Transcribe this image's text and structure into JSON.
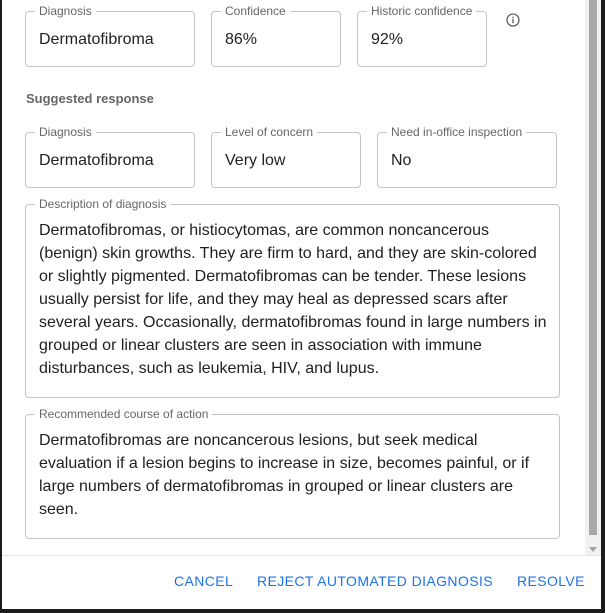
{
  "top_fields": {
    "diagnosis": {
      "label": "Diagnosis",
      "value": "Dermatofibroma"
    },
    "confidence": {
      "label": "Confidence",
      "value": "86%"
    },
    "historic_confidence": {
      "label": "Historic confidence",
      "value": "92%"
    }
  },
  "suggested_response": {
    "title": "Suggested response",
    "diagnosis": {
      "label": "Diagnosis",
      "value": "Dermatofibroma"
    },
    "level_of_concern": {
      "label": "Level of concern",
      "value": "Very low"
    },
    "in_office_inspection": {
      "label": "Need in-office inspection",
      "value": "No"
    },
    "description": {
      "label": "Description of diagnosis",
      "value": "Dermatofibromas, or histiocytomas, are common noncancerous (benign) skin growths. They are firm to hard, and they are skin-colored or slightly pigmented. Dermatofibromas can be tender. These lesions usually persist for life, and they may heal as depressed scars after several years. Occasionally, dermatofibromas found in large numbers in grouped or linear clusters are seen in association with immune disturbances, such as leukemia, HIV, and lupus."
    },
    "course_of_action": {
      "label": "Recommended course of action",
      "value": "Dermatofibromas are noncancerous lesions, but seek medical evaluation if a lesion begins to increase in size, becomes painful, or if large numbers of dermatofibromas in grouped or linear clusters are seen."
    }
  },
  "actions": {
    "cancel": "CANCEL",
    "reject": "REJECT AUTOMATED DIAGNOSIS",
    "resolve": "RESOLVE"
  },
  "icons": {
    "info": "info-icon"
  },
  "colors": {
    "accent": "#1a73e8",
    "border": "#c4c4c4",
    "label": "#666666"
  }
}
